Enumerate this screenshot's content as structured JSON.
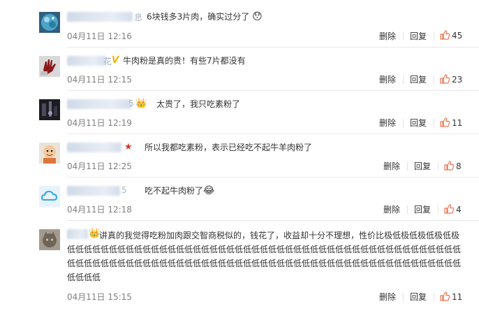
{
  "comments": [
    {
      "avatar": "globe-avatar",
      "name_tail": "息",
      "badge": "",
      "text": "6块钱多3片肉，确实过分了",
      "emoji": "😯",
      "time": "04月11日 12:16",
      "delete_label": "删除",
      "reply_label": "回复",
      "likes": "45"
    },
    {
      "avatar": "hand-avatar",
      "name_tail": "花",
      "badge": "V",
      "text": "牛肉粉是真的贵！有些7片都没有",
      "emoji": "",
      "time": "04月11日 12:15",
      "delete_label": "删除",
      "reply_label": "回复",
      "likes": "23"
    },
    {
      "avatar": "dark-avatar",
      "name_tail": "5",
      "badge": "👑",
      "text": "太贵了，我只吃素粉了",
      "emoji": "",
      "time": "04月11日 12:19",
      "delete_label": "删除",
      "reply_label": "回复",
      "likes": "11"
    },
    {
      "avatar": "child-avatar",
      "name_tail": "",
      "badge": "★",
      "text": "所以我都吃素粉，表示已经吃不起牛羊肉粉了",
      "emoji": "",
      "time": "04月11日 12:25",
      "delete_label": "删除",
      "reply_label": "回复",
      "likes": "8"
    },
    {
      "avatar": "cloud-avatar",
      "name_tail": "5",
      "badge": "",
      "text": "吃不起牛肉粉了",
      "emoji": "😂",
      "time": "04月11日 12:18",
      "delete_label": "删除",
      "reply_label": "回复",
      "likes": "4"
    },
    {
      "avatar": "cat-avatar",
      "name_tail": "",
      "badge": "👑",
      "text": "讲真的我觉得吃粉加肉跟交智商税似的，钱花了，收益却十分不理想，性价比极低极低极低极低极低低低低低低低低低低低低低低低低低低低低低低低低低低低低低低低低低低低低低低低低低低低低低低低低低低低低低低低低低低低低低低低低低低低低低低低低低低低低低低低低低低低低低低低低低低低低低低低低低低",
      "emoji": "",
      "time": "04月11日 15:15",
      "delete_label": "删除",
      "reply_label": "回复",
      "likes": "11"
    }
  ],
  "colors": {
    "like_icon": "#eb7350",
    "crown": "#f5a623",
    "star": "#e0322a",
    "vip_v": "#f4b400",
    "time": "#808080"
  }
}
